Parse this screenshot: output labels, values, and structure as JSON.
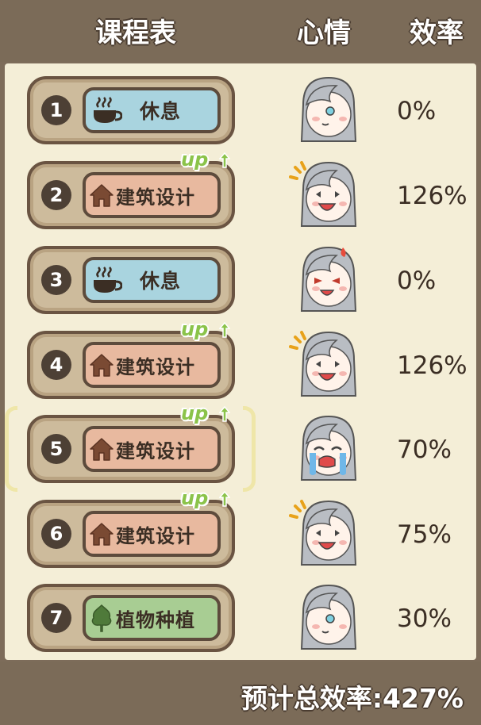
{
  "header": {
    "schedule": "课程表",
    "mood": "心情",
    "efficiency": "效率"
  },
  "rows": [
    {
      "num": "1",
      "course": "休息",
      "type": "rest",
      "icon": "cup-icon",
      "up": "",
      "mood": "neutral",
      "eff": "0%"
    },
    {
      "num": "2",
      "course": "建筑设计",
      "type": "build",
      "icon": "house-icon",
      "up": "up",
      "mood": "happy",
      "eff": "126%"
    },
    {
      "num": "3",
      "course": "休息",
      "type": "rest",
      "icon": "cup-icon",
      "up": "",
      "mood": "angry",
      "eff": "0%"
    },
    {
      "num": "4",
      "course": "建筑设计",
      "type": "build",
      "icon": "house-icon",
      "up": "up",
      "mood": "happy",
      "eff": "126%"
    },
    {
      "num": "5",
      "course": "建筑设计",
      "type": "build",
      "icon": "house-icon",
      "up": "up",
      "mood": "crying",
      "eff": "70%"
    },
    {
      "num": "6",
      "course": "建筑设计",
      "type": "build",
      "icon": "house-icon",
      "up": "up",
      "mood": "happy",
      "eff": "75%"
    },
    {
      "num": "7",
      "course": "植物种植",
      "type": "plant",
      "icon": "leaf-icon",
      "up": "",
      "mood": "neutral",
      "eff": "30%"
    }
  ],
  "footer": {
    "total": "预计总效率:427%"
  },
  "colors": {
    "rest": "#a9d4df",
    "build": "#e8b99f",
    "plant": "#a8cd93",
    "up": "#8bc34a"
  }
}
